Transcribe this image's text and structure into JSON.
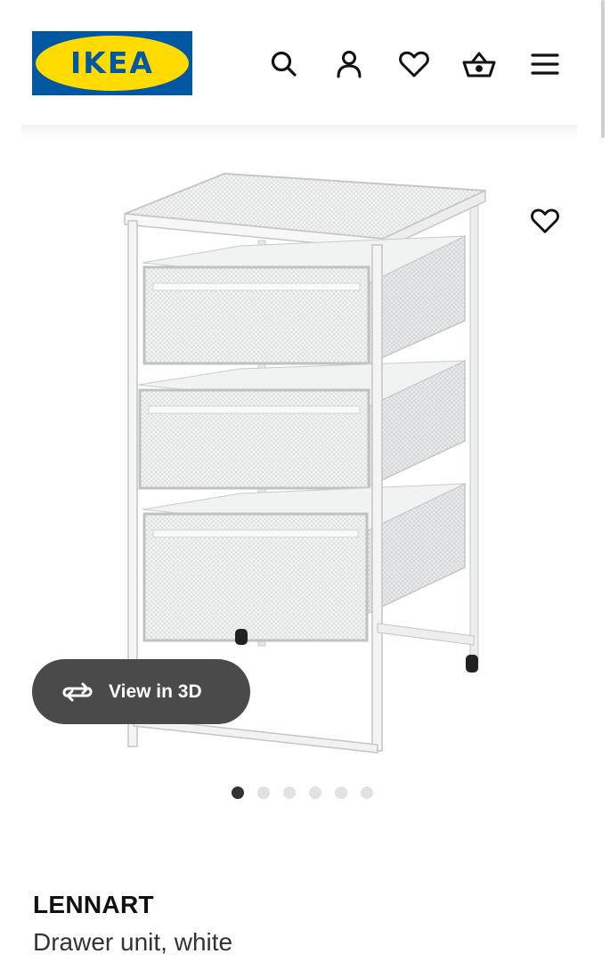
{
  "header": {
    "logo_text": "IKEA",
    "icons": [
      "search-icon",
      "user-icon",
      "heart-icon",
      "shopping-basket-icon",
      "hamburger-menu-icon"
    ]
  },
  "product": {
    "name": "LENNART",
    "description": "Drawer unit, white",
    "image_icon": "drawer-unit-image"
  },
  "gallery": {
    "view_3d_label": "View in 3D",
    "total_images": 6,
    "active_index": 0
  },
  "colors": {
    "ikea_blue": "#0058a3",
    "ikea_yellow": "#ffdb00",
    "pill_background": "#4a4a4a",
    "active_dot": "#333333",
    "inactive_dot": "#e2e2e2"
  }
}
